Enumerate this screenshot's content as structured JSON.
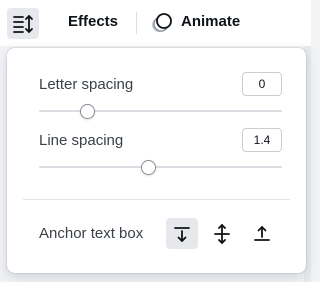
{
  "toolbar": {
    "spacing_icon": "text-spacing-icon",
    "effects_label": "Effects",
    "animate_icon": "animate-icon",
    "animate_label": "Animate"
  },
  "spacing_panel": {
    "letter_spacing": {
      "label": "Letter spacing",
      "value": "0",
      "slider_fraction": 0.2
    },
    "line_spacing": {
      "label": "Line spacing",
      "value": "1.4",
      "slider_fraction": 0.45
    },
    "anchor": {
      "label": "Anchor text box",
      "options": [
        {
          "icon": "anchor-top-icon",
          "selected": true
        },
        {
          "icon": "anchor-middle-icon",
          "selected": false
        },
        {
          "icon": "anchor-bottom-icon",
          "selected": false
        }
      ]
    }
  },
  "colors": {
    "active_button_bg": "#e6e8eb",
    "text": "#0e1318",
    "label_text": "#3b4148",
    "slider_track": "#dadde1"
  }
}
